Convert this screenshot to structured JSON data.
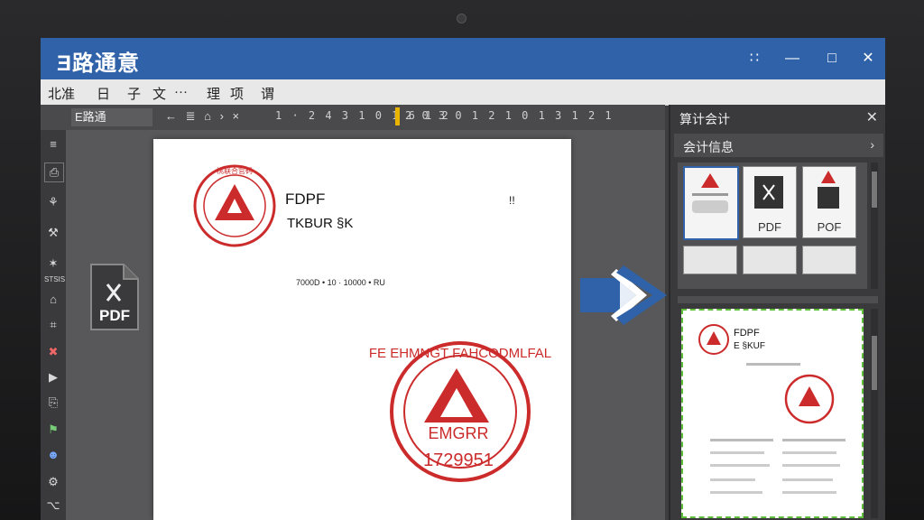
{
  "app": {
    "title": "Ǝ路通意"
  },
  "window_controls": {
    "grid": "∷",
    "minimize": "—",
    "maximize": "□",
    "close": "✕"
  },
  "menu": {
    "items": [
      "北准",
      "日",
      "子",
      "文",
      "···",
      "理",
      "项",
      "谓"
    ]
  },
  "toolbar": {
    "name_field": "E路通",
    "icons": "← ≣ ⌂ › ×",
    "ruler_left": "1 · 2 4 3 1 0 1 6 1 2",
    "ruler_right": "2 0 3 0 1 2 1 0 1 3 1 2 1"
  },
  "left_tools": [
    "≡",
    "⎙",
    "⚘",
    "⚒",
    "✶",
    "⌂",
    "⌗",
    "✖",
    "▶",
    "⎘",
    "⚑",
    "☻",
    "⚙",
    "⌥"
  ],
  "left_tool_text": "STSIS",
  "document": {
    "heading1": "FDPF",
    "heading2": "TKBUR §K",
    "corner_mark": "!!",
    "ref_line": "7000D • 10 · 10000 • RU",
    "stamp_top_text": "桃联合官码",
    "stamp_big_text": "FE EHMNGT FAHCODMLFAL",
    "stamp_big_center": "EMGRR",
    "stamp_big_number": "1729951",
    "stamp_color": "#cc2b2b"
  },
  "pdf_icon_label": "PDF",
  "panel": {
    "title": "算计会计",
    "subheader": "会计信息",
    "thumb_labels": [
      "",
      "PDF",
      "POF"
    ],
    "preview_heading": "FDPF",
    "preview_sub": "E §KUF"
  },
  "colors": {
    "accent": "#2f62a8",
    "stamp": "#cc2b2b",
    "selection": "#5fbf3a",
    "highlight": "#e8b400"
  }
}
